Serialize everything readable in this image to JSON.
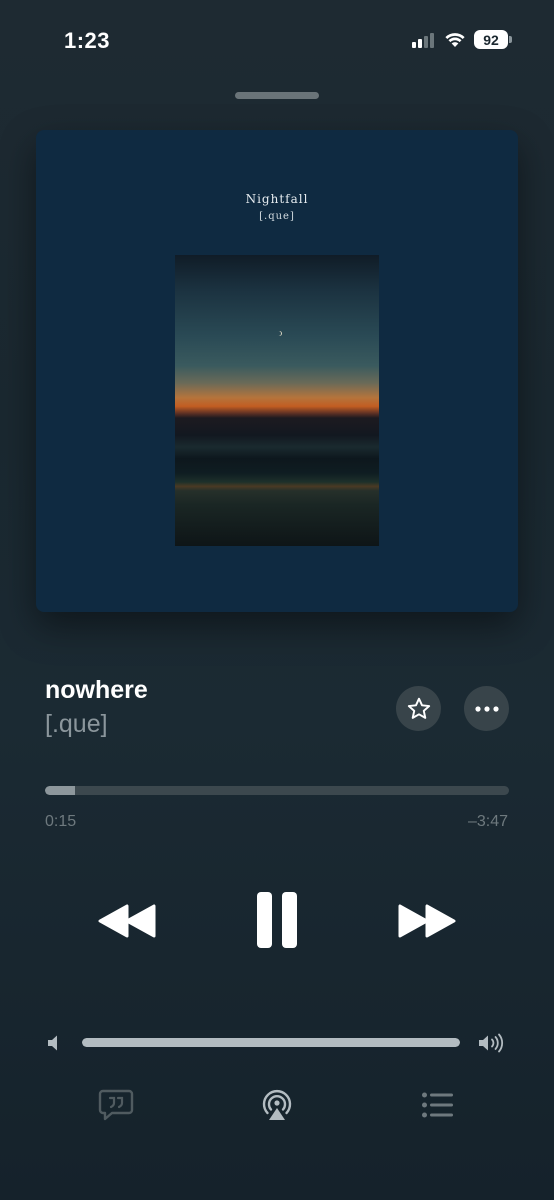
{
  "status_bar": {
    "time": "1:23",
    "battery": "92"
  },
  "artwork": {
    "title": "Nightfall",
    "artist": "[.que]",
    "background_color": "#0f2a41"
  },
  "track": {
    "title": "nowhere",
    "artist": "[.que]"
  },
  "progress": {
    "elapsed": "0:15",
    "remaining": "–3:47",
    "fraction": 0.065
  },
  "volume": {
    "level": 1.0
  },
  "icons": {
    "star": "star-icon",
    "more": "ellipsis-icon",
    "rewind": "rewind-icon",
    "pause": "pause-icon",
    "fast_forward": "fast-forward-icon",
    "volume_low": "speaker-low-icon",
    "volume_high": "speaker-high-icon",
    "lyrics": "lyrics-icon",
    "airplay": "airplay-icon",
    "queue": "queue-list-icon"
  },
  "colors": {
    "primary_text": "#ffffff",
    "secondary_text": "#8b969c",
    "button_bg": "#38444a",
    "track_bg": "#3c484e"
  }
}
